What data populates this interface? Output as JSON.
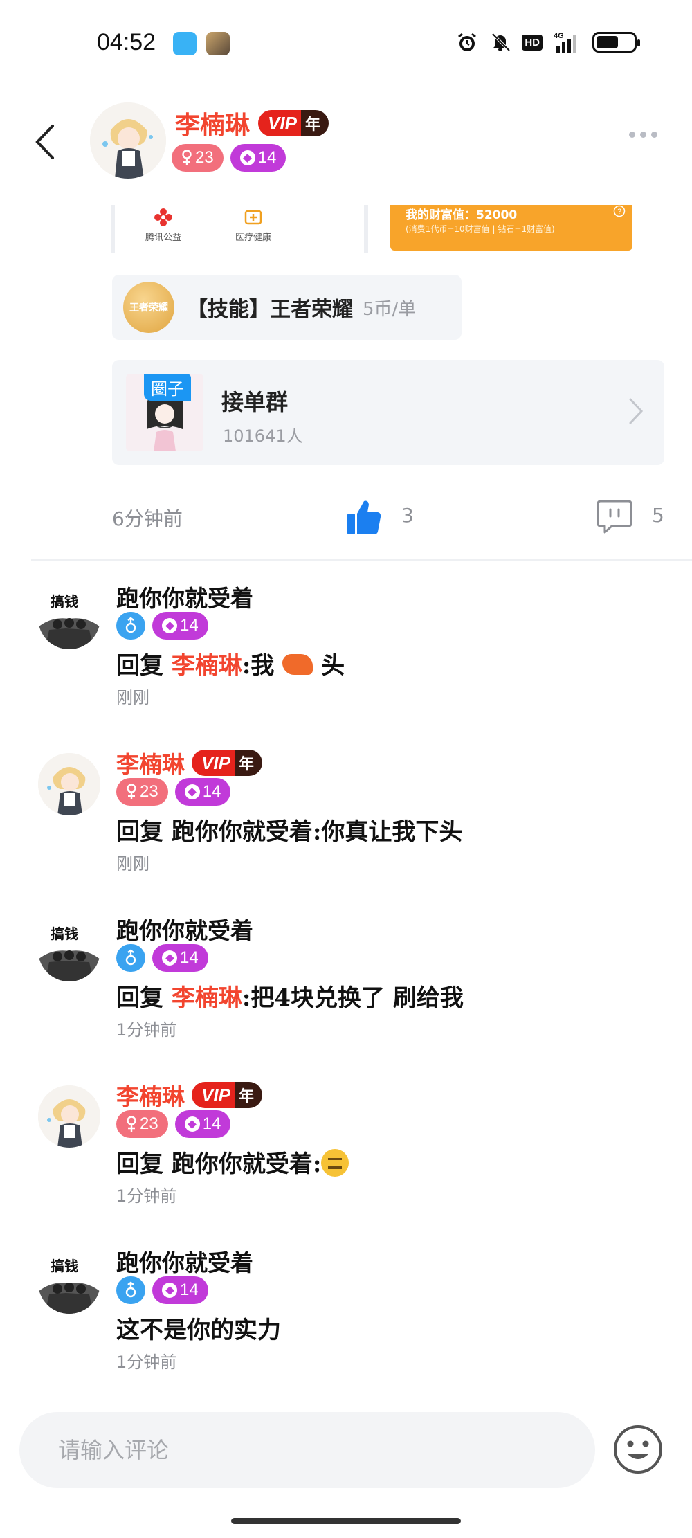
{
  "status_bar": {
    "time": "04:52",
    "network": "4G",
    "hd": "HD",
    "battery_level": 0.6
  },
  "header": {
    "name": "李楠琳",
    "vip": "VIP",
    "vip_term": "年",
    "age": "23",
    "level": "14"
  },
  "partial_cards": {
    "left_items": [
      "腾讯公益",
      "医疗健康"
    ],
    "wealth_title": "我的财富值：52000",
    "wealth_sub": "(消费1代币=10财富值 | 钻石=1财富值)"
  },
  "skill": {
    "icon_text": "王者荣耀",
    "name": "【技能】王者荣耀",
    "price": "5币/单"
  },
  "group": {
    "tag": "圈子",
    "name": "接单群",
    "count": "101641人"
  },
  "stats": {
    "post_time": "6分钟前",
    "likes": "3",
    "comments": "5"
  },
  "comments": [
    {
      "author": "跑你你就受着",
      "style": "plain",
      "level": "14",
      "reply_prefix": "回复 ",
      "reply_to": "李楠琳",
      "text_before_emoji": ":我",
      "text_after_emoji": "头",
      "emoji": "shrimp-emoji",
      "time": "刚刚"
    },
    {
      "author": "李楠琳",
      "style": "vip",
      "vip": "VIP",
      "vip_term": "年",
      "age": "23",
      "level": "14",
      "reply_prefix": "回复 ",
      "reply_to": "跑你你就受着",
      "text": ":你真让我下头",
      "time": "刚刚"
    },
    {
      "author": "跑你你就受着",
      "style": "plain",
      "level": "14",
      "reply_prefix": "回复 ",
      "reply_to": "李楠琳",
      "text": ":把4块兑换了 刷给我",
      "time": "1分钟前"
    },
    {
      "author": "李楠琳",
      "style": "vip",
      "vip": "VIP",
      "vip_term": "年",
      "age": "23",
      "level": "14",
      "reply_prefix": "回复 ",
      "reply_to": "跑你你就受着",
      "text": ":",
      "emoji": "neutral-face-emoji",
      "time": "1分钟前"
    },
    {
      "author": "跑你你就受着",
      "style": "plain",
      "level": "14",
      "text": "这不是你的实力",
      "time": "1分钟前"
    }
  ],
  "avatar_tag": "搞钱",
  "input": {
    "placeholder": "请输入评论"
  },
  "colors": {
    "accent_red": "#f2452f",
    "vip_red": "#e5231c",
    "level_purple": "#c13ad9",
    "female_pink": "#f26f7c",
    "male_blue": "#3aa3f0",
    "like_blue": "#1b7ff0"
  }
}
